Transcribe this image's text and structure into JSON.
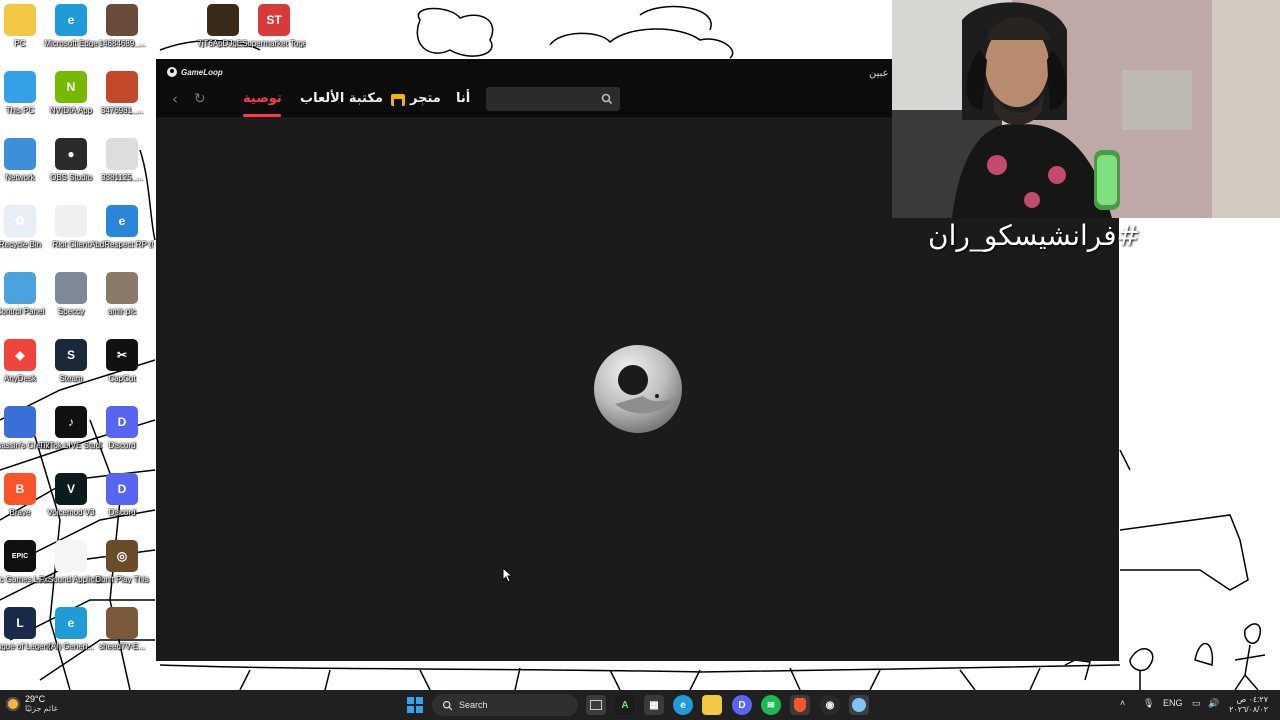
{
  "desktop": {
    "icons": [
      {
        "label": "PC",
        "color": "#f2c744",
        "glyph": ""
      },
      {
        "label": "Microsoft Edge",
        "color": "#1f9bd8",
        "glyph": "e"
      },
      {
        "label": "14684689_...",
        "color": "#6a4a3a",
        "glyph": ""
      },
      {
        "label": "This PC",
        "color": "#35a0e8",
        "glyph": ""
      },
      {
        "label": "NVIDIA App",
        "color": "#76b900",
        "glyph": "N"
      },
      {
        "label": "3476981_...",
        "color": "#c24a2a",
        "glyph": ""
      },
      {
        "label": "Network",
        "color": "#3c8fd8",
        "glyph": ""
      },
      {
        "label": "OBS Studio",
        "color": "#2b2b2b",
        "glyph": "●"
      },
      {
        "label": "3381125_...",
        "color": "#dddddd",
        "glyph": ""
      },
      {
        "label": "Recycle Bin",
        "color": "#e8eef5",
        "glyph": "♻"
      },
      {
        "label": "Riot Client",
        "color": "#f0f0f0",
        "glyph": ""
      },
      {
        "label": "AbdRespect RP (GTA)...",
        "color": "#2a86d8",
        "glyph": "e"
      },
      {
        "label": "Control Panel",
        "color": "#4aa3df",
        "glyph": ""
      },
      {
        "label": "Speccy",
        "color": "#7d8a96",
        "glyph": ""
      },
      {
        "label": "amir pic",
        "color": "#8a7a6a",
        "glyph": ""
      },
      {
        "label": "AnyDesk",
        "color": "#ef443b",
        "glyph": "◆"
      },
      {
        "label": "Steam",
        "color": "#1b2838",
        "glyph": "S"
      },
      {
        "label": "CapCut",
        "color": "#111111",
        "glyph": "✂"
      },
      {
        "label": "Assassin's Creed Mirage",
        "color": "#3a6fd8",
        "glyph": ""
      },
      {
        "label": "TikTok LIVE Studio",
        "color": "#111111",
        "glyph": "♪"
      },
      {
        "label": "Discord",
        "color": "#5865f2",
        "glyph": "D"
      },
      {
        "label": "Brave",
        "color": "#fb542b",
        "glyph": "B"
      },
      {
        "label": "Voicemod V3",
        "color": "#0d1b1e",
        "glyph": "V"
      },
      {
        "label": "Discord",
        "color": "#5865f2",
        "glyph": "D"
      },
      {
        "label": "Epic Games Launcher",
        "color": "#111111",
        "glyph": "EPIC"
      },
      {
        "label": "FxSound Applicati...",
        "color": "#f5f5f5",
        "glyph": ""
      },
      {
        "label": "Don't Play This",
        "color": "#6a4b2a",
        "glyph": "◎"
      },
      {
        "label": "League of Legends",
        "color": "#1a2a4a",
        "glyph": "L"
      },
      {
        "label": "(AI) Generi...",
        "color": "#1f9bd8",
        "glyph": "e"
      },
      {
        "label": "sheed7V-E...",
        "color": "#7a5a3a",
        "glyph": ""
      },
      {
        "label": "7jT6ApDJgE...",
        "color": "#3a2a1a",
        "glyph": ""
      },
      {
        "label": "Supermarket Together",
        "color": "#d83a3a",
        "glyph": "ST"
      }
    ]
  },
  "gameloop": {
    "brand": "GameLoop",
    "user_text": "عبين",
    "tabs": [
      {
        "label": "توصية",
        "active": true
      },
      {
        "label": "مكتبة الألعاب",
        "active": false
      },
      {
        "label": "متجر",
        "active": false
      },
      {
        "label": "أنا",
        "active": false
      }
    ],
    "search_placeholder": "",
    "accent_color": "#ff3b4a"
  },
  "overlay": {
    "hashtag": "#فرانشيسكو_ران"
  },
  "taskbar": {
    "weather_temp": "29°C",
    "weather_desc": "غائم جزئيًا",
    "search_label": "Search",
    "language": "ENG",
    "time": "٠٤:٢٧ ص",
    "date": "٢٠٢٦/٠٨/٠٢",
    "apps": [
      "windows-start-icon",
      "file-explorer-icon",
      "terminal-icon",
      "store-icon",
      "edge-icon",
      "folder-icon",
      "discord-icon",
      "spotify-icon",
      "brave-icon",
      "obs-icon",
      "gameloop-icon"
    ]
  }
}
